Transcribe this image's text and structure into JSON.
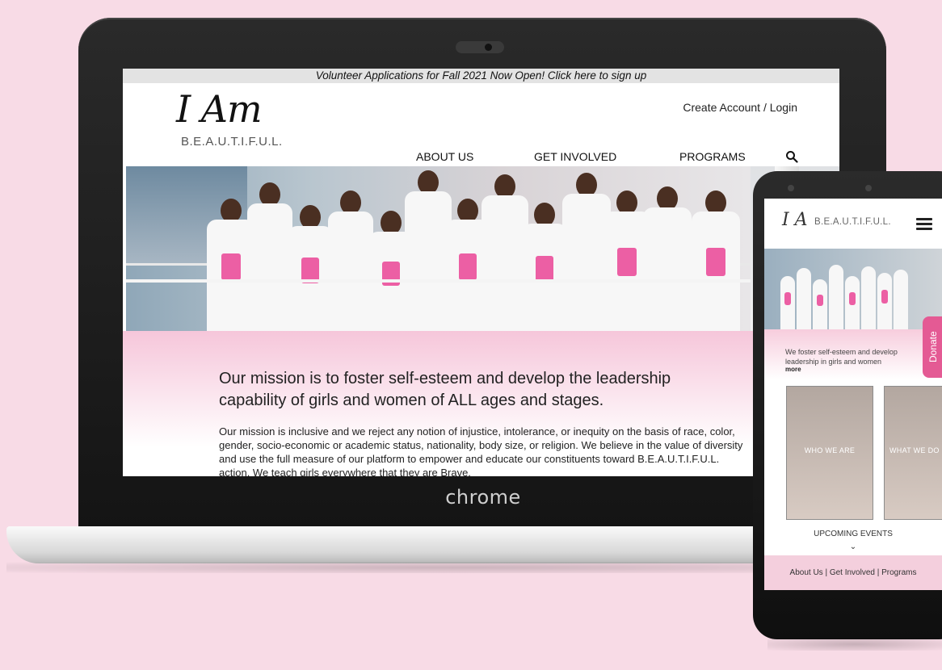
{
  "laptop": {
    "brand": "chrome",
    "announcement": "Volunteer Applications for Fall 2021 Now Open! Click here to sign up",
    "logo_script": "I Am",
    "logo_word": "B.E.A.U.T.I.F.U.L.",
    "account_link": "Create Account / Login",
    "nav": [
      "ABOUT US",
      "GET INVOLVED",
      "PROGRAMS"
    ],
    "mission_title": "Our mission is to foster self-esteem and develop the leadership capability of girls and women of ALL ages and stages.",
    "mission_body": "Our mission is inclusive and we reject any notion of injustice, intolerance, or inequity on the basis of race, color, gender, socio-economic or academic status, nationality, body size, or religion. We believe in the value of diversity and use the full measure of our platform to empower and educate our constituents toward B.E.A.U.T.I.F.U.L. action. We teach girls everywhere that they are Brave,"
  },
  "phone": {
    "logo_script": "I A",
    "logo_word": "B.E.A.U.T.I.F.U.L.",
    "tagline": "We foster self-esteem and develop leadership in girls and women",
    "more": "more",
    "donate": "Donate",
    "cards": [
      "WHO WE ARE",
      "WHAT WE DO"
    ],
    "upcoming": "UPCOMING EVENTS",
    "footer": "About Us | Get Involved | Programs"
  },
  "colors": {
    "background": "#f8dbe6",
    "accent_pink": "#e45a94",
    "mission_band": "#f6c6da"
  }
}
